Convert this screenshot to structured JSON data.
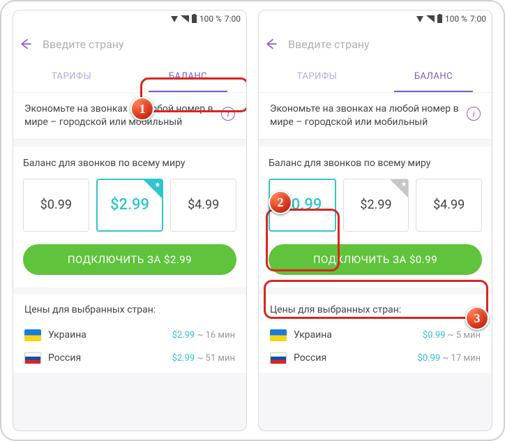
{
  "statusbar": {
    "battery_text": "100 %",
    "time": "7:00"
  },
  "topbar": {
    "search_placeholder": "Введите страну"
  },
  "tabs": {
    "plans": "ТАРИФЫ",
    "balance": "БАЛАНС"
  },
  "info": {
    "text": "Экономьте на звонках на любой номер в мире – городской или мобильный"
  },
  "balance_section": {
    "title": "Баланс для звонков по всему миру"
  },
  "prices": {
    "p1": "$0.99",
    "p2": "$2.99",
    "p3": "$4.99"
  },
  "cta_left": "ПОДКЛЮЧИТЬ ЗА $2.99",
  "cta_right": "ПОДКЛЮЧИТЬ ЗА $0.99",
  "countries_title": "Цены для выбранных стран:",
  "countries_left": {
    "ua": {
      "name": "Украина",
      "price_hl": "$2.99",
      "price_tail": " ~ 16 мин"
    },
    "ru": {
      "name": "Россия",
      "price_hl": "$2.99",
      "price_tail": " ~ 51 мин"
    }
  },
  "countries_right": {
    "ua": {
      "name": "Украина",
      "price_hl": "$0.99",
      "price_tail": " ~ 5 мин"
    },
    "ru": {
      "name": "Россия",
      "price_hl": "$0.99",
      "price_tail": " ~ 17 мин"
    }
  },
  "markers": {
    "m1": "1",
    "m2": "2",
    "m3": "3"
  }
}
